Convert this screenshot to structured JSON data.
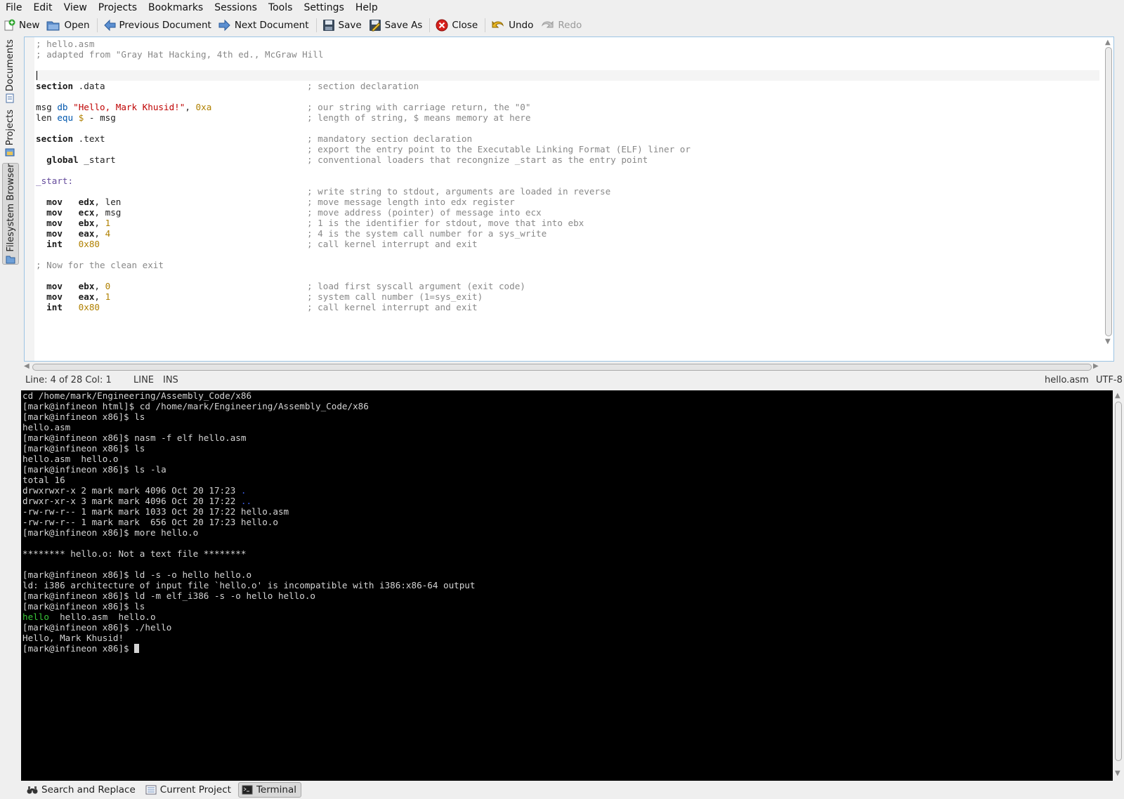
{
  "menu": [
    "File",
    "Edit",
    "View",
    "Projects",
    "Bookmarks",
    "Sessions",
    "Tools",
    "Settings",
    "Help"
  ],
  "toolbar": {
    "new": "New",
    "open": "Open",
    "previous_document": "Previous Document",
    "next_document": "Next Document",
    "save": "Save",
    "save_as": "Save As",
    "close": "Close",
    "undo": "Undo",
    "redo": "Redo"
  },
  "side_tabs": {
    "documents": "Documents",
    "projects": "Projects",
    "filesystem_browser": "Filesystem Browser"
  },
  "editor": {
    "lines": [
      [
        "; hello.asm",
        ""
      ],
      [
        "; adapted from \"Gray Hat Hacking, 4th ed., McGraw Hill",
        ""
      ],
      [
        "",
        ""
      ],
      [
        "",
        ""
      ],
      [
        "section .data",
        "; section declaration"
      ],
      [
        "",
        ""
      ],
      [
        "msg db \"Hello, Mark Khusid!\", 0xa",
        "; our string with carriage return, the \"0\""
      ],
      [
        "len equ $ - msg",
        "; length of string, $ means memory at here"
      ],
      [
        "",
        ""
      ],
      [
        "section .text",
        "; mandatory section declaration"
      ],
      [
        "",
        "; export the entry point to the Executable Linking Format (ELF) liner or"
      ],
      [
        "  global _start",
        "; conventional loaders that recongnize _start as the entry point"
      ],
      [
        "",
        ""
      ],
      [
        "_start:",
        ""
      ],
      [
        "",
        "; write string to stdout, arguments are loaded in reverse"
      ],
      [
        "  mov   edx, len",
        "; move message length into edx register"
      ],
      [
        "  mov   ecx, msg",
        "; move address (pointer) of message into ecx"
      ],
      [
        "  mov   ebx, 1",
        "; 1 is the identifier for stdout, move that into ebx"
      ],
      [
        "  mov   eax, 4",
        "; 4 is the system call number for a sys_write"
      ],
      [
        "  int   0x80",
        "; call kernel interrupt and exit"
      ],
      [
        "",
        ""
      ],
      [
        "; Now for the clean exit",
        ""
      ],
      [
        "",
        ""
      ],
      [
        "  mov   ebx, 0",
        "; load first syscall argument (exit code)"
      ],
      [
        "  mov   eax, 1",
        "; system call number (1=sys_exit)"
      ],
      [
        "  int   0x80",
        "; call kernel interrupt and exit"
      ]
    ]
  },
  "status": {
    "position": "Line: 4 of 28 Col: 1",
    "mode": "LINE",
    "insert": "INS",
    "filename": "hello.asm",
    "encoding": "UTF-8"
  },
  "terminal": {
    "lines": [
      "cd /home/mark/Engineering/Assembly_Code/x86",
      "[mark@infineon html]$ cd /home/mark/Engineering/Assembly_Code/x86",
      "[mark@infineon x86]$ ls",
      "hello.asm",
      "[mark@infineon x86]$ nasm -f elf hello.asm",
      "[mark@infineon x86]$ ls",
      "hello.asm  hello.o",
      "[mark@infineon x86]$ ls -la",
      "total 16",
      "drwxrwxr-x 2 mark mark 4096 Oct 20 17:23 .",
      "drwxr-xr-x 3 mark mark 4096 Oct 20 17:22 ..",
      "-rw-rw-r-- 1 mark mark 1033 Oct 20 17:22 hello.asm",
      "-rw-rw-r-- 1 mark mark  656 Oct 20 17:23 hello.o",
      "[mark@infineon x86]$ more hello.o",
      "",
      "******** hello.o: Not a text file ********",
      "",
      "[mark@infineon x86]$ ld -s -o hello hello.o",
      "ld: i386 architecture of input file `hello.o' is incompatible with i386:x86-64 output",
      "[mark@infineon x86]$ ld -m elf_i386 -s -o hello hello.o",
      "[mark@infineon x86]$ ls",
      "hello  hello.asm  hello.o",
      "[mark@infineon x86]$ ./hello",
      "Hello, Mark Khusid!",
      "[mark@infineon x86]$ "
    ]
  },
  "bottom_tabs": {
    "search_replace": "Search and Replace",
    "current_project": "Current Project",
    "terminal": "Terminal"
  },
  "colors": {
    "terminal_bg": "#000000",
    "terminal_fg": "#d4d4d4",
    "executable": "#39c739",
    "directory": "#3b5ee6",
    "editor_border": "#9cc4e4"
  }
}
